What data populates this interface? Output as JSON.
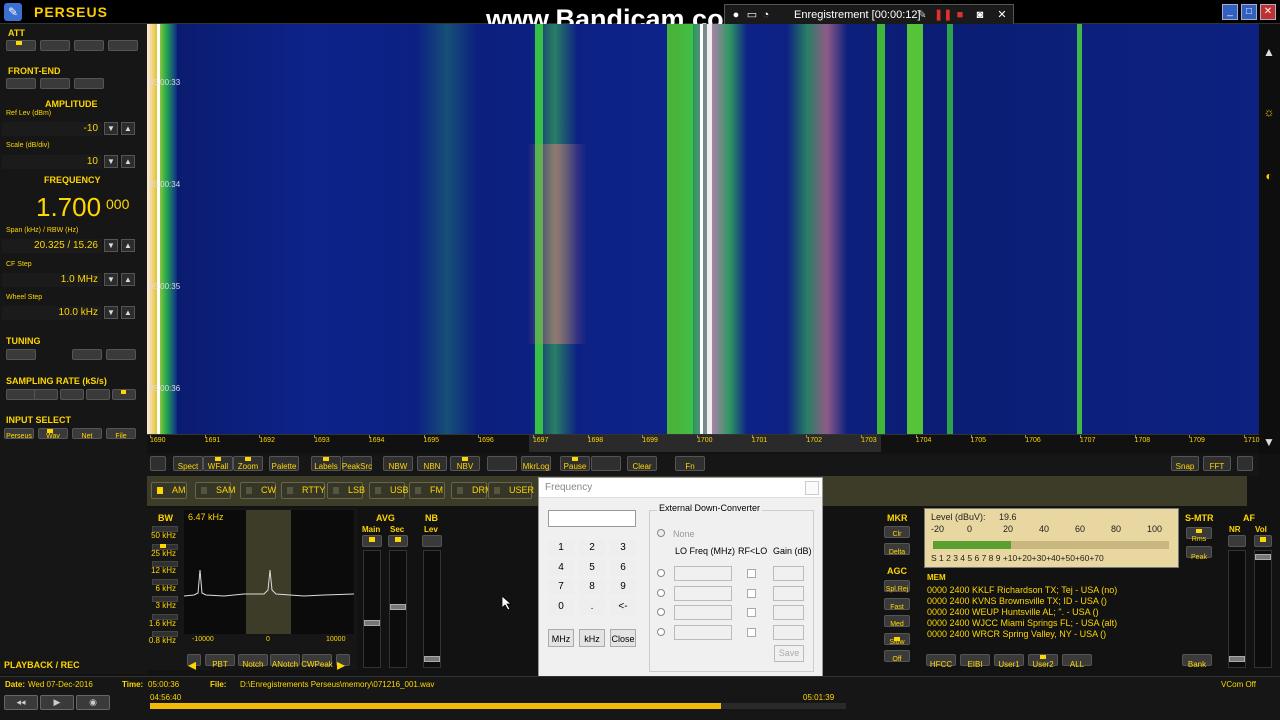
{
  "window": {
    "app_title": "PERSEUS",
    "watermark": "www.Bandicam.com",
    "recording": "Enregistrement [00:00:12]"
  },
  "left_panel": {
    "att": "ATT",
    "front_end": "FRONT-END",
    "amplitude": "AMPLITUDE",
    "ref_lev_label": "Ref Lev (dBm)",
    "ref_lev_value": "-10",
    "scale_label": "Scale (dB/div)",
    "scale_value": "10",
    "frequency": "FREQUENCY",
    "freq_main": "1.700",
    "freq_fine": "000",
    "span_label": "Span (kHz) / RBW (Hz)",
    "span_value": "20.325 / 15.26",
    "cf_step_label": "CF Step",
    "cf_step_value": "1.0 MHz",
    "wheel_step_label": "Wheel Step",
    "wheel_step_value": "10.0 kHz",
    "tuning": "TUNING",
    "sampling_rate": "SAMPLING RATE (kS/s)",
    "input_select": "INPUT SELECT",
    "input_buttons": [
      "Perseus",
      "Wav",
      "Net",
      "File"
    ],
    "playback_rec": "PLAYBACK / REC"
  },
  "waterfall": {
    "times": [
      "05:00:33",
      "05:00:34",
      "05:00:35",
      "05:00:36"
    ]
  },
  "axis": {
    "ticks": [
      "1690",
      "1691",
      "1692",
      "1693",
      "1694",
      "1695",
      "1696",
      "1697",
      "1698",
      "1699",
      "1700",
      "1701",
      "1702",
      "1703",
      "1704",
      "1705",
      "1706",
      "1707",
      "1708",
      "1709",
      "1710"
    ]
  },
  "toolbar": {
    "buttons": [
      "Spect",
      "WFall",
      "Zoom",
      "Palette",
      "Labels",
      "PeakSrc",
      "NBW",
      "NBN",
      "NBV",
      "",
      "MkrLog",
      "Pause",
      "",
      "Clear",
      "Fn"
    ],
    "right_buttons": [
      "Snap",
      "FFT"
    ]
  },
  "modes": [
    "AM",
    "SAM",
    "CW",
    "RTTY",
    "LSB",
    "USB",
    "FM",
    "DRM",
    "USER"
  ],
  "bandwidth": {
    "title": "BW",
    "current": "6.47 kHz",
    "options": [
      "50 kHz",
      "25 kHz",
      "12 kHz",
      "6 kHz",
      "3 kHz",
      "1.6 kHz",
      "0.8 kHz"
    ],
    "scale": [
      "-10000",
      "0",
      "10000"
    ],
    "bottom_buttons": [
      "PBT",
      "Notch",
      "ANotch",
      "CWPeak"
    ]
  },
  "avg": {
    "title": "AVG",
    "main": "Main",
    "sec": "Sec"
  },
  "nb": {
    "title": "NB",
    "lev": "Lev"
  },
  "mkr": {
    "title": "MKR",
    "buttons": [
      "Clr",
      "Delta"
    ]
  },
  "agc": {
    "title": "AGC",
    "buttons": [
      "Spl.Rej",
      "Fast",
      "Med",
      "Slow",
      "Off"
    ]
  },
  "level_meter": {
    "label": "Level (dBuV):",
    "value": "19.6",
    "top_scale": [
      "-20",
      "0",
      "20",
      "40",
      "60",
      "80",
      "100"
    ],
    "bottom_scale": "S 1 2 3 4 5 6 7 8 9 +10+20+30+40+50+60+70"
  },
  "smtr": {
    "title": "S-MTR",
    "buttons": [
      "Rms",
      "Peak"
    ]
  },
  "af": {
    "title": "AF",
    "nr": "NR",
    "vol": "Vol"
  },
  "memory": {
    "title": "MEM",
    "rows": [
      "0000 2400  KKLF Richardson TX; Tej - USA (no)",
      "0000 2400  KVNS Brownsville TX; ID - USA ()",
      "0000 2400  WEUP Huntsville AL; \". - USA ()",
      "0000 2400  WJCC Miami Springs FL;  - USA (alt)",
      "0000 2400  WRCR Spring Valley, NY  - USA ()"
    ],
    "buttons": [
      "HFCC",
      "EIBI",
      "User1",
      "User2",
      "ALL",
      "Bank"
    ]
  },
  "dialog": {
    "title": "Frequency",
    "keys": [
      "1",
      "2",
      "3",
      "4",
      "5",
      "6",
      "7",
      "8",
      "9",
      "0",
      ".",
      "<-"
    ],
    "units": [
      "MHz",
      "kHz",
      "Close"
    ],
    "edc_title": "External Down-Converter",
    "none_label": "None",
    "col_lo": "LO Freq (MHz)",
    "col_rf": "RF<LO",
    "col_gain": "Gain (dB)",
    "save": "Save"
  },
  "status": {
    "date_label": "Date:",
    "date_value": "Wed 07-Dec-2016",
    "time_label": "Time:",
    "time_value": "05:00:36",
    "file_label": "File:",
    "file_value": "D:\\Enregistrements Perseus\\memory\\071216_001.wav",
    "start": "04:56:40",
    "end": "05:01:39",
    "vcom": "VCom Off",
    "progress": 0.82
  }
}
